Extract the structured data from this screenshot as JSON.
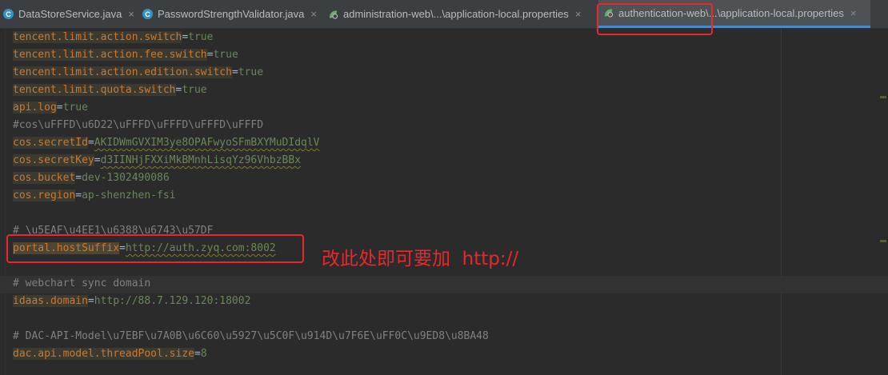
{
  "tabs": [
    {
      "label": "DataStoreService.java",
      "icon": "class-icon",
      "active": false
    },
    {
      "label": "PasswordStrengthValidator.java",
      "icon": "class-icon",
      "active": false
    },
    {
      "label": "administration-web\\...\\application-local.properties",
      "icon": "spring-leaf-icon",
      "active": false
    },
    {
      "label": "authentication-web\\...\\application-local.properties",
      "icon": "spring-leaf-icon",
      "active": true
    }
  ],
  "tab_close_glyph": "×",
  "lines": [
    {
      "key": "tencent.limit.action.switch",
      "eq": "=",
      "value": "true"
    },
    {
      "key": "tencent.limit.action.fee.switch",
      "eq": "=",
      "value": "true"
    },
    {
      "key": "tencent.limit.action.edition.switch",
      "eq": "=",
      "value": "true"
    },
    {
      "key": "tencent.limit.quota.switch",
      "eq": "=",
      "value": "true"
    },
    {
      "key": "api.log",
      "eq": "=",
      "value": "true"
    },
    {
      "comment": "#cos\\uFFFD\\u6D22\\uFFFD\\uFFFD\\uFFFD\\uFFFD"
    },
    {
      "key": "cos.secretId",
      "eq": "=",
      "value": "AKIDWmGVXIM3ye8OPAFwyoSFmBXYMuDIdqlV"
    },
    {
      "key": "cos.secretKey",
      "eq": "=",
      "value": "d3IINHjFXXiMkBMnhLisqYz96VhbzBBx"
    },
    {
      "key": "cos.bucket",
      "eq": "=",
      "value": "dev-1302490086"
    },
    {
      "key": "cos.region",
      "eq": "=",
      "value": "ap-shenzhen-fsi"
    },
    {
      "comment": "# \\u5EAF\\u4EE1\\u6388\\u6743\\u57DF"
    },
    {
      "key": "portal.hostSuffix",
      "eq": "=",
      "value": "http://auth.zyq.com:8002"
    },
    {
      "comment": "# webchart sync domain"
    },
    {
      "key": "idaas.domain",
      "eq": "=",
      "value": "http://88.7.129.120:18002"
    },
    {
      "comment": "# DAC-API-Model\\u7EBF\\u7A0B\\u6C60\\u5927\\u5C0F\\u914D\\u7F6E\\uFF0C\\u9ED8\\u8BA48"
    },
    {
      "key": "dac.api.model.threadPool.size",
      "eq": "=",
      "value": "8"
    }
  ],
  "annotation": "改此处即可要加  http://",
  "colors": {
    "accent_red": "#e8282b",
    "key": "#cc7832",
    "value": "#6a8759",
    "comment": "#808080"
  }
}
